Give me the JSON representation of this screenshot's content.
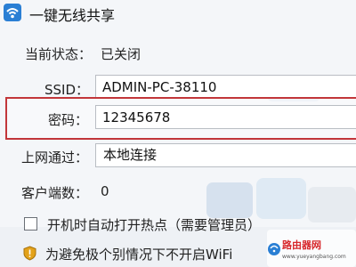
{
  "window": {
    "title": "一键无线共享"
  },
  "status": {
    "label": "当前状态：",
    "value": "已关闭"
  },
  "ssid": {
    "label": "SSID：",
    "value": "ADMIN-PC-38110"
  },
  "password": {
    "label": "密码：",
    "value": "12345678"
  },
  "connection": {
    "label": "上网通过：",
    "value": "本地连接"
  },
  "clients": {
    "label": "客户端数：",
    "value": "0"
  },
  "autostart": {
    "label": "开机时自动打开热点（需要管理员）",
    "checked": false
  },
  "notice": {
    "text": "为避免极个别情况下不开启WiFi"
  },
  "watermark": {
    "brand": "路由器网",
    "url": "www.yueyangbang.com"
  },
  "colors": {
    "highlight": "#c2363a",
    "warning": "#e3a21a"
  }
}
